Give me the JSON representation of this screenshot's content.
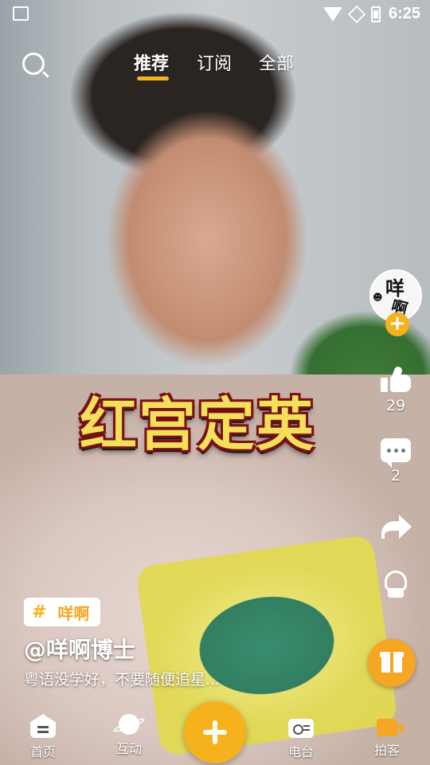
{
  "status": {
    "time": "6:25"
  },
  "topnav": {
    "tabs": [
      {
        "label": "推荐"
      },
      {
        "label": "订阅"
      },
      {
        "label": "全部"
      }
    ]
  },
  "caption": "红宫定英",
  "sidebar": {
    "avatar_text": [
      "咩",
      "啊"
    ],
    "follow_symbol": "+",
    "likes": "29",
    "comments": "2"
  },
  "video": {
    "tag": {
      "hash": "#",
      "label": "咩啊"
    },
    "author": "@咩啊博士",
    "description": "粤语没学好，不要随便追星..."
  },
  "bottomnav": {
    "items": [
      {
        "label": "首页"
      },
      {
        "label": "互动"
      },
      {
        "label": "电台"
      },
      {
        "label": "拍客"
      }
    ]
  },
  "colors": {
    "accent": "#f6b21c",
    "caption_fill": "#f3e05a",
    "caption_stroke": "#7a0f14"
  }
}
